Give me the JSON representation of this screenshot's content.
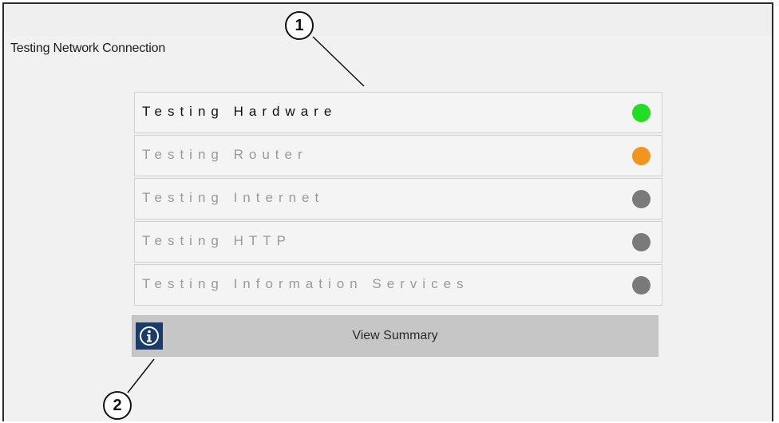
{
  "window": {
    "title": "Testing Network Connection"
  },
  "tests": [
    {
      "label": "Testing Hardware",
      "state": "active",
      "status_color": "#22dd22"
    },
    {
      "label": "Testing Router",
      "state": "inactive",
      "status_color": "#f0961e"
    },
    {
      "label": "Testing Internet",
      "state": "inactive",
      "status_color": "#7a7a7a"
    },
    {
      "label": "Testing HTTP",
      "state": "inactive",
      "status_color": "#7a7a7a"
    },
    {
      "label": "Testing Information Services",
      "state": "inactive",
      "status_color": "#7a7a7a"
    }
  ],
  "summary": {
    "label": "View Summary",
    "icon": "info-icon"
  },
  "callouts": {
    "one": "1",
    "two": "2"
  }
}
